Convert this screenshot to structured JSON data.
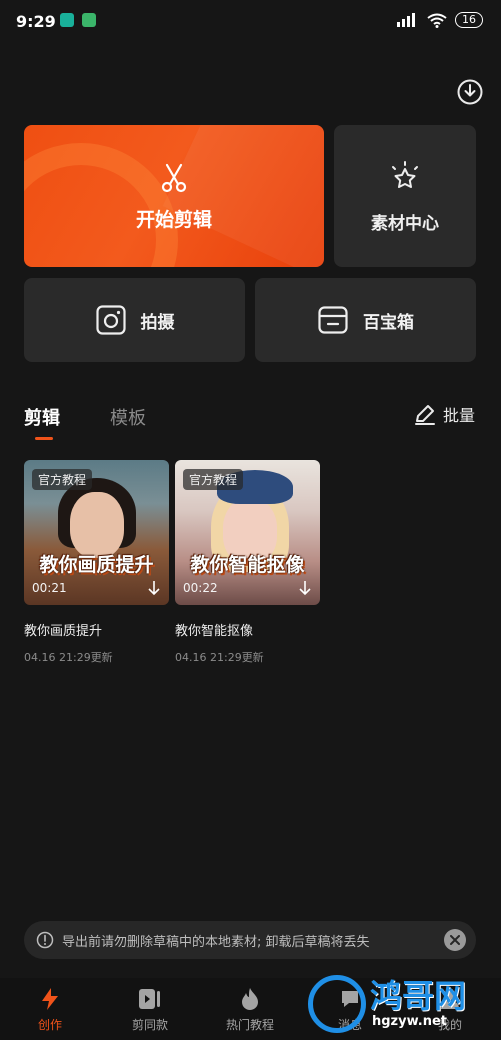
{
  "status_bar": {
    "time": "9:29",
    "battery": "16"
  },
  "home": {
    "start_edit": "开始剪辑",
    "material_center": "素材中心",
    "shoot": "拍摄",
    "toolbox": "百宝箱"
  },
  "tabs": {
    "active": "剪辑",
    "inactive": "模板",
    "batch": "批量"
  },
  "drafts": [
    {
      "badge": "官方教程",
      "caption": "教你画质提升",
      "duration": "00:21",
      "title": "教你画质提升",
      "meta": "04.16 21:29更新"
    },
    {
      "badge": "官方教程",
      "caption": "教你智能抠像",
      "duration": "00:22",
      "title": "教你智能抠像",
      "meta": "04.16 21:29更新"
    }
  ],
  "notice": {
    "text": "导出前请勿删除草稿中的本地素材; 卸载后草稿将丢失"
  },
  "bottom_nav": [
    {
      "label": "创作",
      "icon": "lightning-icon",
      "active": true
    },
    {
      "label": "剪同款",
      "icon": "template-video-icon",
      "active": false
    },
    {
      "label": "热门教程",
      "icon": "flame-icon",
      "active": false
    },
    {
      "label": "消息",
      "icon": "message-icon",
      "active": false
    },
    {
      "label": "我的",
      "icon": "profile-icon",
      "active": false
    }
  ],
  "watermark": {
    "title": "鸿哥网",
    "url": "hgzyw.net"
  },
  "colors": {
    "accent": "#f0531a",
    "background": "#161616",
    "card": "#2a2a2a"
  }
}
